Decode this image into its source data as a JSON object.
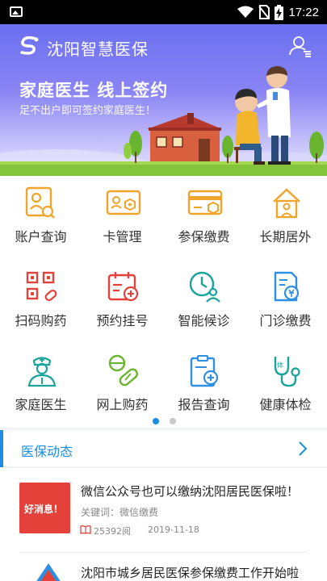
{
  "status_bar": {
    "time": "17:22"
  },
  "banner": {
    "app_title": "沈阳智慧医保",
    "headline": "家庭医生 线上签约",
    "subline": "足不出户即可签约家庭医生！"
  },
  "services": [
    {
      "label": "账户查询",
      "icon": "account-query-icon"
    },
    {
      "label": "卡管理",
      "icon": "card-manage-icon"
    },
    {
      "label": "参保缴费",
      "icon": "insurance-pay-icon"
    },
    {
      "label": "长期居外",
      "icon": "live-abroad-icon"
    },
    {
      "label": "扫码购药",
      "icon": "scan-buy-medicine-icon"
    },
    {
      "label": "预约挂号",
      "icon": "appointment-icon"
    },
    {
      "label": "智能候诊",
      "icon": "smart-queue-icon"
    },
    {
      "label": "门诊缴费",
      "icon": "outpatient-pay-icon"
    },
    {
      "label": "家庭医生",
      "icon": "family-doctor-icon"
    },
    {
      "label": "网上购药",
      "icon": "online-pharmacy-icon"
    },
    {
      "label": "报告查询",
      "icon": "report-query-icon"
    },
    {
      "label": "健康体检",
      "icon": "health-checkup-icon"
    }
  ],
  "pager": {
    "active_index": 0,
    "count": 2
  },
  "news": {
    "section_title": "医保动态",
    "items": [
      {
        "title": "微信公众号也可以缴纳沈阳居民医保啦！",
        "keywords": "关键词：微信缴费",
        "views": "25392阅",
        "date": "2019-11-18",
        "thumb_text": "好消息！"
      },
      {
        "title": "沈阳市城乡居民医保参保缴费工作开始啦"
      }
    ]
  },
  "colors": {
    "accent": "#1a8ce3",
    "icon_orange": "#f0a52a",
    "icon_red": "#e4413a",
    "icon_teal": "#1aa39a",
    "icon_blue": "#2f8fe0"
  }
}
